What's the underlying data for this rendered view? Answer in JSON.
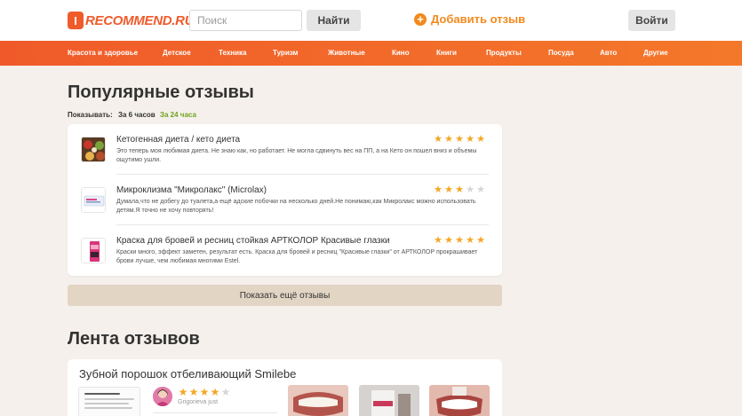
{
  "header": {
    "logo_badge": "I",
    "logo_text": "RECOMMEND.RU",
    "search_placeholder": "Поиск",
    "search_button": "Найти",
    "add_review_icon": "+",
    "add_review": "Добавить отзыв",
    "login_button": "Войти"
  },
  "nav": {
    "items": [
      "Красота и здоровье",
      "Детское",
      "Техника",
      "Туризм",
      "Животные",
      "Кино",
      "Книги",
      "Продукты",
      "Посуда",
      "Авто",
      "Другие"
    ]
  },
  "popular": {
    "title": "Популярные отзывы",
    "show_label": "Показывать:",
    "filter_6h": "За 6 часов",
    "filter_24h": "За 24 часа",
    "reviews": [
      {
        "title": "Кетогенная диета / кето диета",
        "text": "Это теперь моя любимая диета. Не знаю как, но работает. Не могла сдвинуть вес на ПП, а на Кето он пошел вниз и объемы ощутимо ушли.",
        "rating": 5,
        "thumb_icon": "food-thumbnail"
      },
      {
        "title": "Микроклизма \"Микролакс\" (Microlax)",
        "text": "Думала,что не добегу до туалета,а ещё адские побочки на несколько дней.Не понимаю,как Микролакс можно использовать детям.Я точно не хочу повторять!",
        "rating": 3,
        "thumb_icon": "medicine-box-thumbnail"
      },
      {
        "title": "Краска для бровей и ресниц стойкая АРТКОЛОР Красивые глазки",
        "text": "Краски много, эффект заметен, результат есть. Краска для бровей и ресниц \"Красивые глазки\" от АРТКОЛОР прокрашивает брови лучше, чем любимая многими Estel.",
        "rating": 5,
        "thumb_icon": "dye-box-thumbnail"
      }
    ],
    "more_button": "Показать ещё отзывы"
  },
  "feed": {
    "title": "Лента отзывов",
    "item": {
      "title": "Зубной порошок отбеливающий Smilebe",
      "user": "Grigorieva just",
      "rating": 4
    }
  },
  "colors": {
    "brand": "#ef5b2b",
    "accent": "#f28a1c",
    "star": "#f5a623",
    "active_filter": "#6fa31d",
    "background": "#f5f0eb"
  }
}
